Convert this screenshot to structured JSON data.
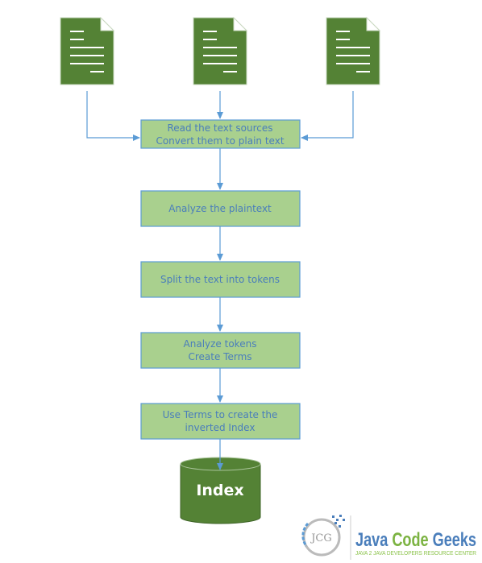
{
  "diagram": {
    "sources": [
      {
        "icon": "document-icon"
      },
      {
        "icon": "document-icon"
      },
      {
        "icon": "document-icon"
      }
    ],
    "steps": [
      {
        "lines": [
          "Read the text sources",
          "Convert them to plain text"
        ]
      },
      {
        "lines": [
          "Analyze the plaintext"
        ]
      },
      {
        "lines": [
          "Split the text into tokens"
        ]
      },
      {
        "lines": [
          "Analyze tokens",
          "Create Terms"
        ]
      },
      {
        "lines": [
          "Use Terms to create the",
          "inverted Index"
        ]
      }
    ],
    "output": {
      "label": "Index",
      "icon": "database-icon"
    }
  },
  "logo": {
    "name": "Java Code Geeks",
    "tagline": "Java 2 Java Developers Resource Center",
    "mark": "JCG"
  },
  "colors": {
    "step_fill": "#a9d08e",
    "step_border": "#5b9bd5",
    "text": "#4a7ebb",
    "doc": "#548235",
    "arrow": "#5b9bd5"
  }
}
